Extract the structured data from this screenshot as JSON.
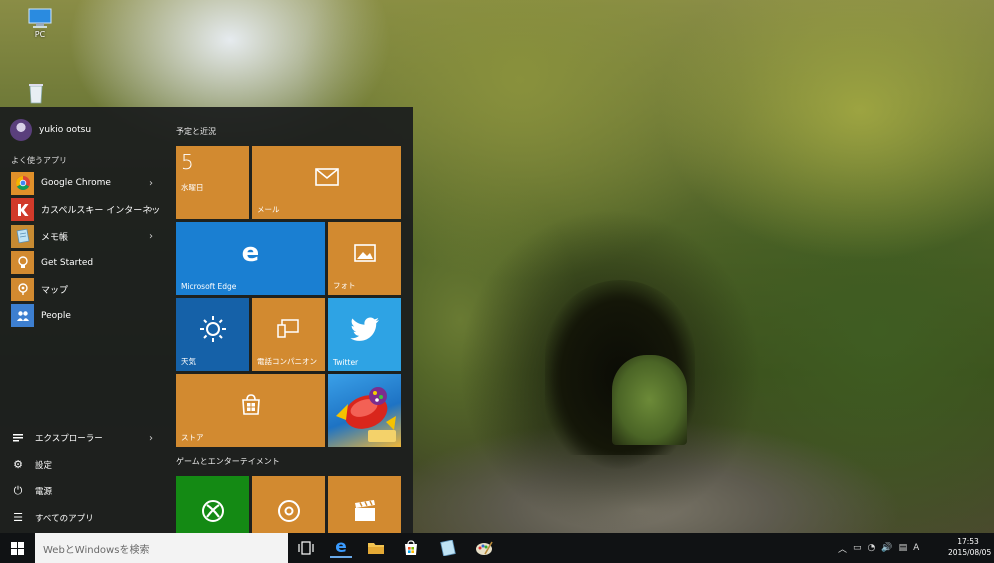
{
  "desktop": {
    "icons": [
      {
        "label": "PC",
        "icon": "computer-icon"
      },
      {
        "label": "",
        "icon": "recycle-bin-icon"
      }
    ]
  },
  "start_menu": {
    "user": {
      "name": "yukio ootsu"
    },
    "frequent_label": "よく使うアプリ",
    "apps": [
      {
        "label": "Google Chrome",
        "icon": "chrome-icon",
        "has_submenu": true
      },
      {
        "label": "カスペルスキー インターネッ...",
        "icon": "kaspersky-icon",
        "has_submenu": true
      },
      {
        "label": "メモ帳",
        "icon": "notepad-icon",
        "has_submenu": true
      },
      {
        "label": "Get Started",
        "icon": "lightbulb-icon",
        "has_submenu": false
      },
      {
        "label": "マップ",
        "icon": "maps-icon",
        "has_submenu": false
      },
      {
        "label": "People",
        "icon": "people-icon",
        "has_submenu": false
      }
    ],
    "bottom": [
      {
        "label": "エクスプローラー",
        "icon": "explorer-icon",
        "has_submenu": true
      },
      {
        "label": "設定",
        "icon": "gear-icon",
        "has_submenu": false
      },
      {
        "label": "電源",
        "icon": "power-icon",
        "has_submenu": false
      },
      {
        "label": "すべてのアプリ",
        "icon": "all-apps-icon",
        "has_submenu": false
      }
    ],
    "groups": {
      "life": "予定と近況",
      "entertainment": "ゲームとエンターテイメント"
    },
    "tiles": {
      "calendar": {
        "day": "5",
        "weekday": "水曜日"
      },
      "mail": "メール",
      "edge": "Microsoft Edge",
      "photos": "フォト",
      "weather": "天気",
      "phone": "電話コンパニオン",
      "twitter": "Twitter",
      "store": "ストア",
      "candy": "",
      "xbox": "",
      "groove": "",
      "movies": ""
    }
  },
  "taskbar": {
    "search_placeholder": "WebとWindowsを検索",
    "pinned": [
      "task-view-icon",
      "edge-icon",
      "file-explorer-icon",
      "store-icon",
      "notepad-icon",
      "paint-icon"
    ],
    "tray_ime": "A",
    "clock_time": "17:53",
    "clock_date": "2015/08/05"
  },
  "colors": {
    "tile_orange": "#d28a30",
    "tile_blue": "#1a7fd2",
    "tile_green": "#148a14",
    "twitter_blue": "#2ea3e4"
  }
}
